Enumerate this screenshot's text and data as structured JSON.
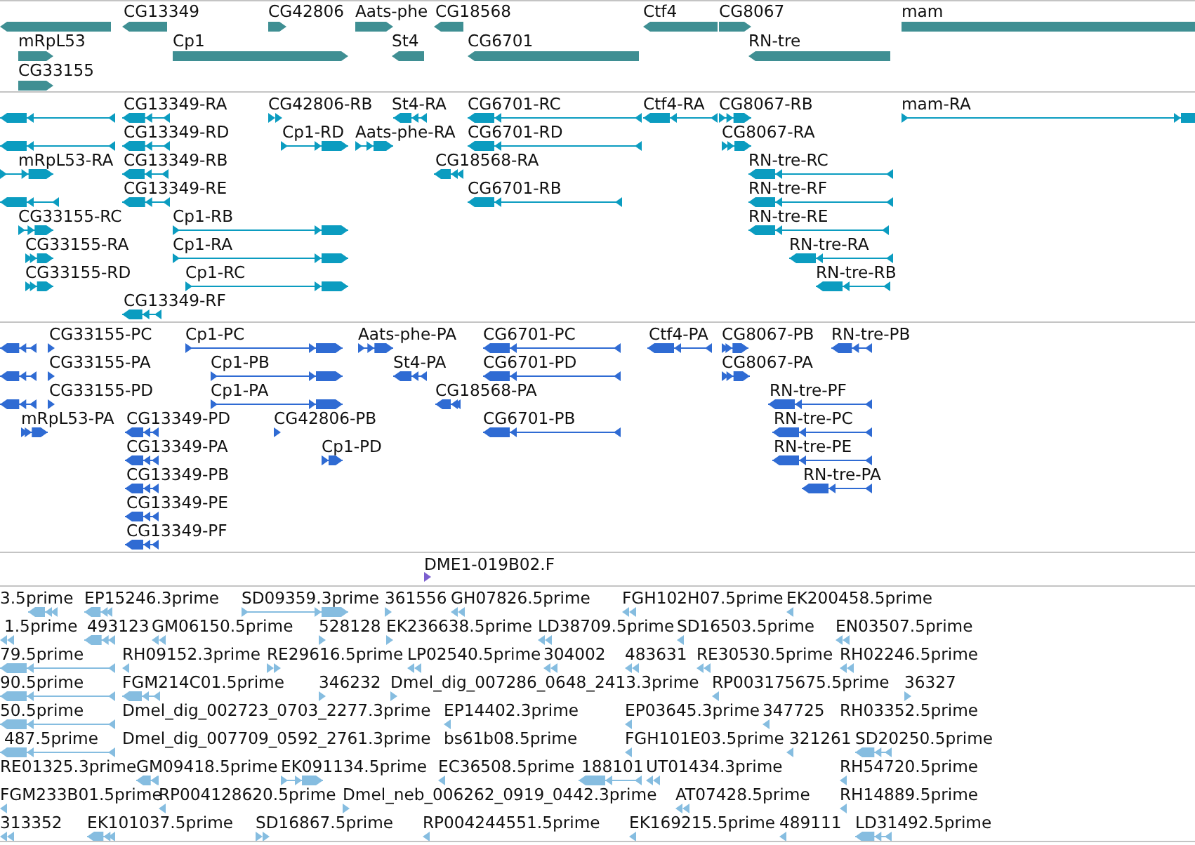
{
  "tracks": [
    {
      "kind": "bar",
      "color": "#3f8f93",
      "features": [
        {
          "reverse": true
        },
        {
          "label": "CG13349",
          "reverse": true
        },
        {
          "label": "CG42806",
          "reverse": false
        },
        {
          "label": "Aats-phe",
          "reverse": false
        },
        {
          "label": "CG18568",
          "reverse": true
        },
        {
          "label": "Ctf4",
          "reverse": true
        },
        {
          "label": "CG8067",
          "reverse": false
        },
        {
          "label": "mam",
          "reverse": false
        },
        {
          "label": "mRpL53",
          "reverse": false
        },
        {
          "label": "Cp1",
          "reverse": false
        },
        {
          "label": "St4",
          "reverse": true
        },
        {
          "label": "CG6701",
          "reverse": true
        },
        {
          "label": "RN-tre",
          "reverse": true
        },
        {
          "label": "CG33155",
          "reverse": false
        }
      ]
    },
    {
      "kind": "model",
      "color": "#0b9cc0",
      "features": [
        {
          "reverse": true
        },
        {
          "label": "CG13349-RA",
          "reverse": true
        },
        {
          "label": "CG42806-RB",
          "reverse": false
        },
        {
          "label": "St4-RA",
          "reverse": true
        },
        {
          "label": "CG6701-RC",
          "reverse": true
        },
        {
          "label": "Ctf4-RA",
          "reverse": true
        },
        {
          "label": "CG8067-RB",
          "reverse": false
        },
        {
          "label": "mam-RA",
          "reverse": false
        },
        {
          "reverse": true
        },
        {
          "label": "CG13349-RD",
          "reverse": true
        },
        {
          "label": "Cp1-RD",
          "reverse": false
        },
        {
          "label": "Aats-phe-RA",
          "reverse": false
        },
        {
          "label": "CG6701-RD",
          "reverse": true
        },
        {
          "label": "CG8067-RA",
          "reverse": false
        },
        {
          "label": "mRpL53-RA",
          "reverse": false
        },
        {
          "label": "CG13349-RB",
          "reverse": true
        },
        {
          "label": "CG18568-RA",
          "reverse": true
        },
        {
          "label": "RN-tre-RC",
          "reverse": true
        },
        {
          "reverse": true
        },
        {
          "label": "CG13349-RE",
          "reverse": true
        },
        {
          "label": "CG6701-RB",
          "reverse": true
        },
        {
          "label": "RN-tre-RF",
          "reverse": true
        },
        {
          "label": "CG33155-RC",
          "reverse": false
        },
        {
          "label": "Cp1-RB",
          "reverse": false
        },
        {
          "label": "RN-tre-RE",
          "reverse": true
        },
        {
          "label": "CG33155-RA",
          "reverse": false
        },
        {
          "label": "Cp1-RA",
          "reverse": false
        },
        {
          "label": "RN-tre-RA",
          "reverse": true
        },
        {
          "label": "CG33155-RD",
          "reverse": false
        },
        {
          "label": "Cp1-RC",
          "reverse": false
        },
        {
          "label": "RN-tre-RB",
          "reverse": true
        },
        {
          "label": "CG13349-RF",
          "reverse": true
        }
      ]
    },
    {
      "kind": "model",
      "color": "#2f6bd3",
      "features": [
        {
          "reverse": true
        },
        {
          "label": "CG33155-PC",
          "reverse": false
        },
        {
          "label": "Cp1-PC",
          "reverse": false
        },
        {
          "label": "Aats-phe-PA",
          "reverse": false
        },
        {
          "label": "CG6701-PC",
          "reverse": true
        },
        {
          "label": "Ctf4-PA",
          "reverse": true
        },
        {
          "label": "CG8067-PB",
          "reverse": false
        },
        {
          "label": "RN-tre-PB",
          "reverse": true
        },
        {
          "reverse": true
        },
        {
          "label": "CG33155-PA",
          "reverse": false
        },
        {
          "label": "Cp1-PB",
          "reverse": false
        },
        {
          "label": "St4-PA",
          "reverse": true
        },
        {
          "label": "CG6701-PD",
          "reverse": true
        },
        {
          "label": "CG8067-PA",
          "reverse": false
        },
        {
          "reverse": true
        },
        {
          "label": "CG33155-PD",
          "reverse": false
        },
        {
          "label": "Cp1-PA",
          "reverse": false
        },
        {
          "label": "CG18568-PA",
          "reverse": true
        },
        {
          "label": "RN-tre-PF",
          "reverse": true
        },
        {
          "label": "mRpL53-PA",
          "reverse": false
        },
        {
          "label": "CG13349-PD",
          "reverse": true
        },
        {
          "label": "CG42806-PB",
          "reverse": false
        },
        {
          "label": "CG6701-PB",
          "reverse": true
        },
        {
          "label": "RN-tre-PC",
          "reverse": true
        },
        {
          "label": "CG13349-PA",
          "reverse": true
        },
        {
          "label": "Cp1-PD",
          "reverse": false
        },
        {
          "label": "RN-tre-PE",
          "reverse": true
        },
        {
          "label": "CG13349-PB",
          "reverse": true
        },
        {
          "label": "RN-tre-PA",
          "reverse": true
        },
        {
          "label": "CG13349-PE",
          "reverse": true
        },
        {
          "label": "CG13349-PF",
          "reverse": true
        }
      ]
    },
    {
      "kind": "model",
      "color": "#7b5fcf",
      "features": [
        {
          "label": "DME1-019B02.F",
          "reverse": false
        }
      ]
    },
    {
      "kind": "model",
      "color": "#86bde0",
      "features": [
        {
          "label": "3.5prime",
          "reverse": true
        },
        {
          "label": "EP15246.3prime",
          "reverse": true
        },
        {
          "label": "SD09359.3prime",
          "reverse": false
        },
        {
          "label": "361556",
          "reverse": false
        },
        {
          "label": "GH07826.5prime",
          "reverse": true
        },
        {
          "label": "FGH102H07.5prime",
          "reverse": true
        },
        {
          "label": "EK200458.5prime",
          "reverse": true
        },
        {
          "label": "1.5prime",
          "reverse": true
        },
        {
          "label": "493123",
          "reverse": true
        },
        {
          "label": "GM06150.5prime",
          "reverse": true
        },
        {
          "label": "528128",
          "reverse": false
        },
        {
          "label": "EK236638.5prime",
          "reverse": false
        },
        {
          "label": "LD38709.5prime",
          "reverse": true
        },
        {
          "label": "SD16503.5prime",
          "reverse": true
        },
        {
          "label": "EN03507.5prime",
          "reverse": true
        },
        {
          "label": "79.5prime",
          "reverse": true
        },
        {
          "label": "RH09152.3prime",
          "reverse": true
        },
        {
          "label": "RE29616.5prime",
          "reverse": false
        },
        {
          "label": "LP02540.5prime",
          "reverse": true
        },
        {
          "label": "304002",
          "reverse": true
        },
        {
          "label": "483631",
          "reverse": true
        },
        {
          "label": "RE30530.5prime",
          "reverse": true
        },
        {
          "label": "RH02246.5prime",
          "reverse": true
        },
        {
          "label": "90.5prime",
          "reverse": true
        },
        {
          "label": "FGM214C01.5prime",
          "reverse": true
        },
        {
          "label": "346232",
          "reverse": false
        },
        {
          "label": "Dmel_dig_007286_0648_2413.3prime",
          "reverse": false
        },
        {
          "label": "RP003175675.5prime",
          "reverse": true
        },
        {
          "label": "36327",
          "reverse": false
        },
        {
          "label": "50.5prime",
          "reverse": true
        },
        {
          "label": "Dmel_dig_002723_0703_2277.3prime"
        },
        {
          "label": "EP14402.3prime",
          "reverse": true
        },
        {
          "label": "EP03645.3prime",
          "reverse": true
        },
        {
          "label": "347725",
          "reverse": true
        },
        {
          "label": "RH03352.5prime"
        },
        {
          "label": "487.5prime",
          "reverse": true
        },
        {
          "label": "Dmel_dig_007709_0592_2761.3prime"
        },
        {
          "label": "bs61b08.5prime"
        },
        {
          "label": "FGH101E03.5prime",
          "reverse": true
        },
        {
          "label": "321261",
          "reverse": true
        },
        {
          "label": "SD20250.5prime",
          "reverse": true
        },
        {
          "label": "RE01325.3prime"
        },
        {
          "label": "GM09418.5prime",
          "reverse": true
        },
        {
          "label": "EK091134.5prime",
          "reverse": false
        },
        {
          "label": "EC36508.5prime",
          "reverse": true
        },
        {
          "label": "188101",
          "reverse": true
        },
        {
          "label": "UT01434.3prime",
          "reverse": true
        },
        {
          "label": "RH54720.5prime",
          "reverse": true
        },
        {
          "label": "FGM233B01.5prime",
          "reverse": true
        },
        {
          "label": "RP004128620.5prime",
          "reverse": true
        },
        {
          "label": "Dmel_neb_006262_0919_0442.3prime",
          "reverse": false
        },
        {
          "label": "AT07428.5prime",
          "reverse": true
        },
        {
          "label": "RH14889.5prime",
          "reverse": true
        },
        {
          "label": "313352",
          "reverse": true
        },
        {
          "label": "EK101037.5prime",
          "reverse": true
        },
        {
          "label": "SD16867.5prime",
          "reverse": false
        },
        {
          "label": "RP004244551.5prime",
          "reverse": true
        },
        {
          "label": "EK169215.5prime",
          "reverse": true
        },
        {
          "label": "489111",
          "reverse": true
        },
        {
          "label": "LD31492.5prime",
          "reverse": true
        }
      ]
    }
  ]
}
